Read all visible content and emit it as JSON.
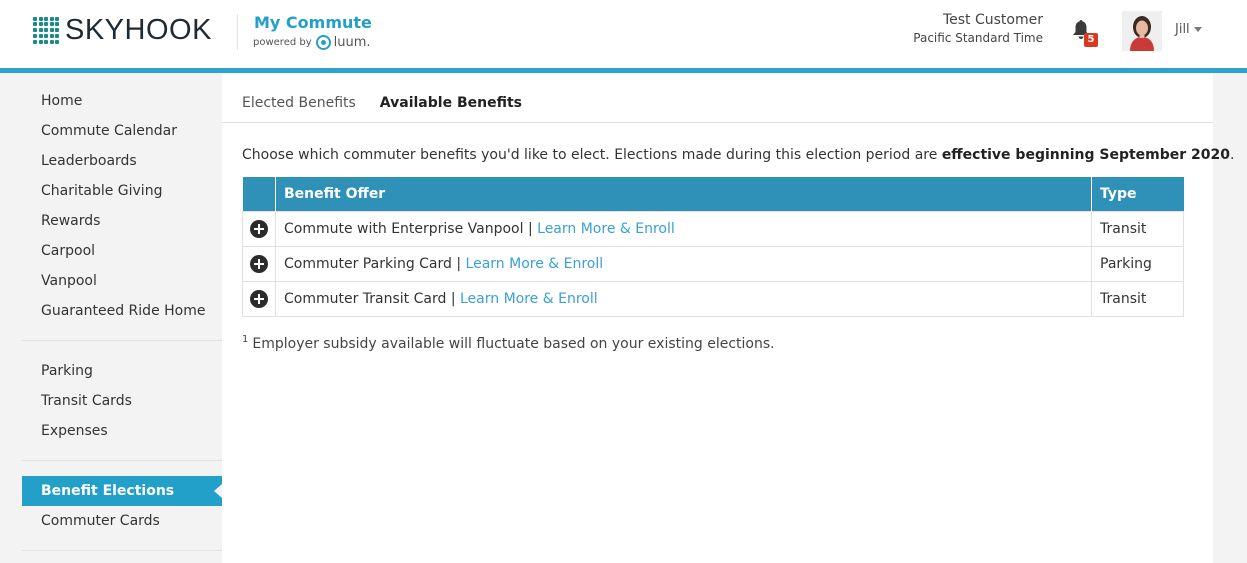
{
  "header": {
    "brand": "SKYHOOK",
    "app_title": "My Commute",
    "powered_by": "powered by",
    "powered_brand": "luum.",
    "user_name": "Test Customer",
    "timezone": "Pacific Standard Time",
    "notification_count": "5",
    "user_short": "Jill"
  },
  "sidebar": {
    "group1": [
      "Home",
      "Commute Calendar",
      "Leaderboards",
      "Charitable Giving",
      "Rewards",
      "Carpool",
      "Vanpool",
      "Guaranteed Ride Home"
    ],
    "group2": [
      "Parking",
      "Transit Cards",
      "Expenses"
    ],
    "group3": [
      "Benefit Elections",
      "Commuter Cards"
    ],
    "active": "Benefit Elections"
  },
  "tabs": [
    "Elected Benefits",
    "Available Benefits"
  ],
  "active_tab": "Available Benefits",
  "intro": {
    "text": "Choose which commuter benefits you'd like to elect. Elections made during this election period are ",
    "bold": "effective beginning September 2020",
    "end": "."
  },
  "table": {
    "headers": [
      "Benefit Offer",
      "Type"
    ],
    "rows": [
      {
        "offer": "Commute with Enterprise Vanpool",
        "sep": " | ",
        "link": "Learn More & Enroll",
        "type": "Transit"
      },
      {
        "offer": "Commuter Parking Card",
        "sep": " | ",
        "link": "Learn More & Enroll",
        "type": "Parking"
      },
      {
        "offer": "Commuter Transit Card",
        "sep": " | ",
        "link": "Learn More & Enroll",
        "type": "Transit"
      }
    ]
  },
  "footnote": {
    "marker": "1",
    "text": "Employer subsidy available will fluctuate based on your existing elections."
  },
  "colors": {
    "accent": "#23a0c9",
    "table_header": "#2f90b8",
    "link": "#3aa0d5",
    "badge": "#d9381e"
  }
}
